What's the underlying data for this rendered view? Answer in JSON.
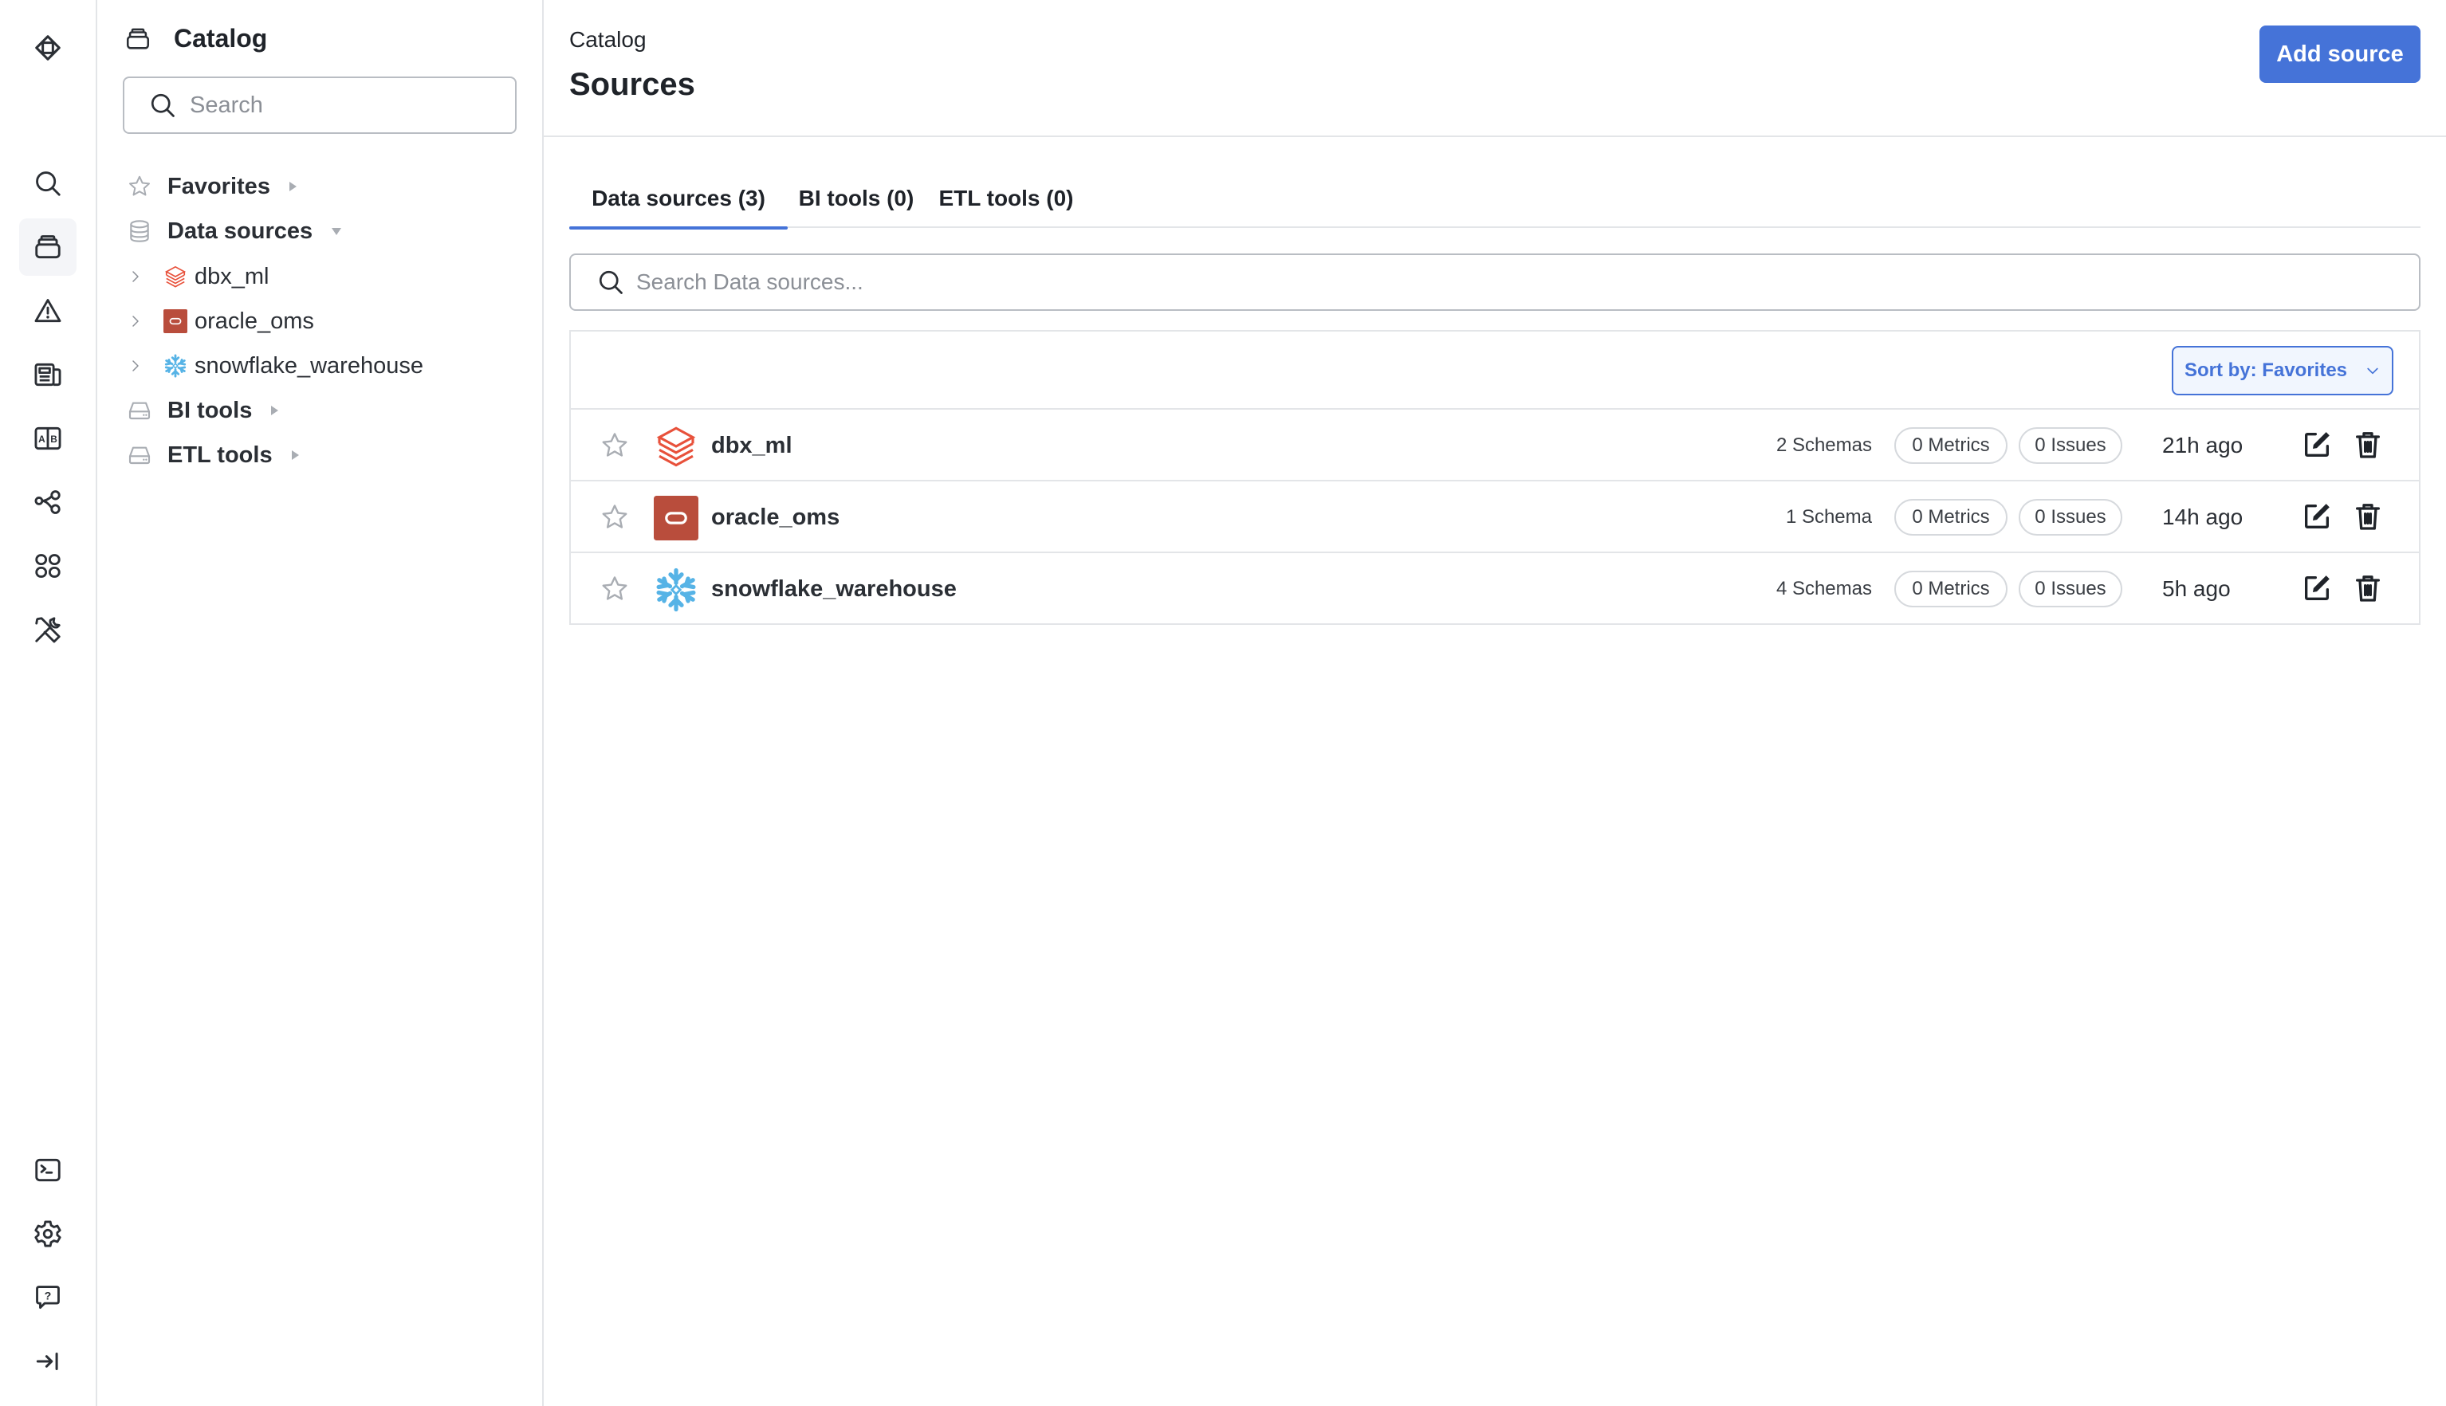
{
  "rail": {
    "items": [
      {
        "icon": "logo-icon"
      },
      {
        "icon": "search-icon"
      },
      {
        "icon": "catalog-icon",
        "active": true
      },
      {
        "icon": "alert-icon"
      },
      {
        "icon": "news-icon"
      },
      {
        "icon": "ab-test-icon"
      },
      {
        "icon": "lineage-icon"
      },
      {
        "icon": "apps-grid-icon"
      },
      {
        "icon": "tools-icon"
      },
      {
        "icon": "terminal-icon"
      },
      {
        "icon": "settings-icon"
      },
      {
        "icon": "help-icon"
      },
      {
        "icon": "expand-sidebar-icon"
      }
    ]
  },
  "sidebar": {
    "title": "Catalog",
    "search_placeholder": "Search",
    "sections": [
      {
        "label": "Favorites",
        "icon": "star-icon",
        "expanded": false
      },
      {
        "label": "Data sources",
        "icon": "database-icon",
        "expanded": true,
        "children": [
          {
            "label": "dbx_ml",
            "icon": "databricks-icon"
          },
          {
            "label": "oracle_oms",
            "icon": "oracle-icon"
          },
          {
            "label": "snowflake_warehouse",
            "icon": "snowflake-icon"
          }
        ]
      },
      {
        "label": "BI tools",
        "icon": "drive-icon",
        "expanded": false
      },
      {
        "label": "ETL tools",
        "icon": "drive-icon",
        "expanded": false
      }
    ]
  },
  "header": {
    "breadcrumb": "Catalog",
    "title": "Sources",
    "add_button": "Add source"
  },
  "tabs": [
    {
      "label": "Data sources (3)",
      "active": true
    },
    {
      "label": "BI tools (0)",
      "active": false
    },
    {
      "label": "ETL tools (0)",
      "active": false
    }
  ],
  "search": {
    "placeholder": "Search Data sources..."
  },
  "sort": {
    "label": "Sort by: Favorites"
  },
  "sources": [
    {
      "name": "dbx_ml",
      "icon": "databricks-icon",
      "schemas": "2 Schemas",
      "metrics": "0 Metrics",
      "issues": "0 Issues",
      "updated": "21h ago"
    },
    {
      "name": "oracle_oms",
      "icon": "oracle-icon",
      "schemas": "1 Schema",
      "metrics": "0 Metrics",
      "issues": "0 Issues",
      "updated": "14h ago"
    },
    {
      "name": "snowflake_warehouse",
      "icon": "snowflake-icon",
      "schemas": "4 Schemas",
      "metrics": "0 Metrics",
      "issues": "0 Issues",
      "updated": "5h ago"
    }
  ],
  "colors": {
    "accent": "#4573d8",
    "databricks": "#e8513b",
    "oracle": "#b94d3c",
    "snowflake": "#56b3e6"
  }
}
